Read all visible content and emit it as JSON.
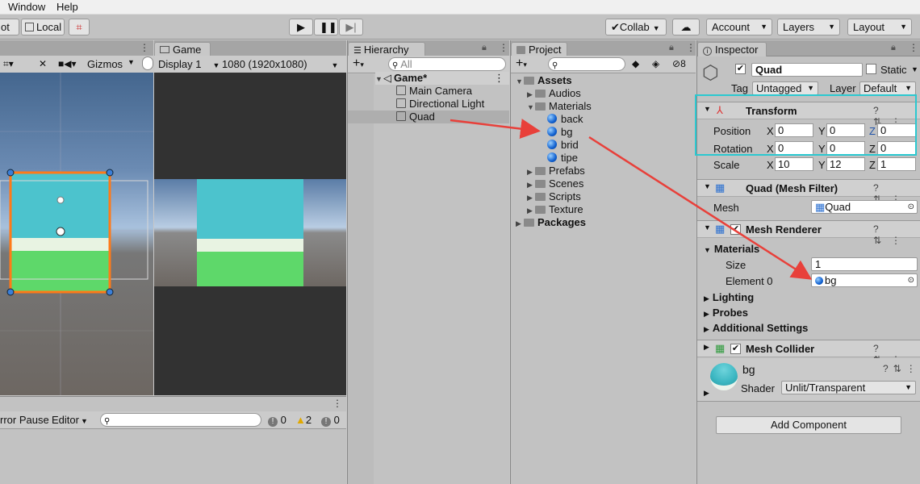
{
  "menubar": {
    "window": "Window",
    "help": "Help"
  },
  "toolbar": {
    "pivot_partial": "ot",
    "local": "Local",
    "collab": "Collab",
    "account": "Account",
    "layers": "Layers",
    "layout": "Layout"
  },
  "scene": {
    "gizmos": "Gizmos"
  },
  "game": {
    "tab": "Game",
    "display": "Display 1",
    "resolution": "1080 (1920x1080)"
  },
  "console": {
    "error_pause_partial": "rror Pause",
    "editor": "Editor",
    "count_info": "0",
    "count_warn": "2",
    "count_error": "0"
  },
  "hierarchy": {
    "tab": "Hierarchy",
    "search_placeholder": "All",
    "items": [
      {
        "label": "Game*"
      },
      {
        "label": "Main Camera"
      },
      {
        "label": "Directional Light"
      },
      {
        "label": "Quad"
      }
    ]
  },
  "project": {
    "tab": "Project",
    "hidden_count": "8",
    "items": [
      {
        "label": "Assets"
      },
      {
        "label": "Audios"
      },
      {
        "label": "Materials"
      },
      {
        "label": "back"
      },
      {
        "label": "bg"
      },
      {
        "label": "brid"
      },
      {
        "label": "tipe"
      },
      {
        "label": "Prefabs"
      },
      {
        "label": "Scenes"
      },
      {
        "label": "Scripts"
      },
      {
        "label": "Texture"
      },
      {
        "label": "Packages"
      }
    ]
  },
  "inspector": {
    "tab": "Inspector",
    "object_name": "Quad",
    "static_label": "Static",
    "tag_label": "Tag",
    "tag_value": "Untagged",
    "layer_label": "Layer",
    "layer_value": "Default",
    "transform": {
      "title": "Transform",
      "position_label": "Position",
      "rotation_label": "Rotation",
      "scale_label": "Scale",
      "position": {
        "x": "0",
        "y": "0",
        "z": "0"
      },
      "rotation": {
        "x": "0",
        "y": "0",
        "z": "0"
      },
      "scale": {
        "x": "10",
        "y": "12",
        "z": "1"
      },
      "x": "X",
      "y": "Y",
      "z": "Z"
    },
    "mesh_filter": {
      "title": "Quad (Mesh Filter)",
      "mesh_label": "Mesh",
      "mesh_value": "Quad"
    },
    "mesh_renderer": {
      "title": "Mesh Renderer",
      "materials_label": "Materials",
      "size_label": "Size",
      "size_value": "1",
      "element0_label": "Element 0",
      "element0_value": "bg",
      "lighting": "Lighting",
      "probes": "Probes",
      "additional": "Additional Settings"
    },
    "mesh_collider": {
      "title": "Mesh Collider"
    },
    "material": {
      "name": "bg",
      "shader_label": "Shader",
      "shader_value": "Unlit/Transparent"
    },
    "add_component": "Add Component"
  },
  "colors": {
    "selection_box": "#2bc8d0",
    "annotation_arrow": "#e8403a",
    "selection_orange": "#ff7a18"
  }
}
